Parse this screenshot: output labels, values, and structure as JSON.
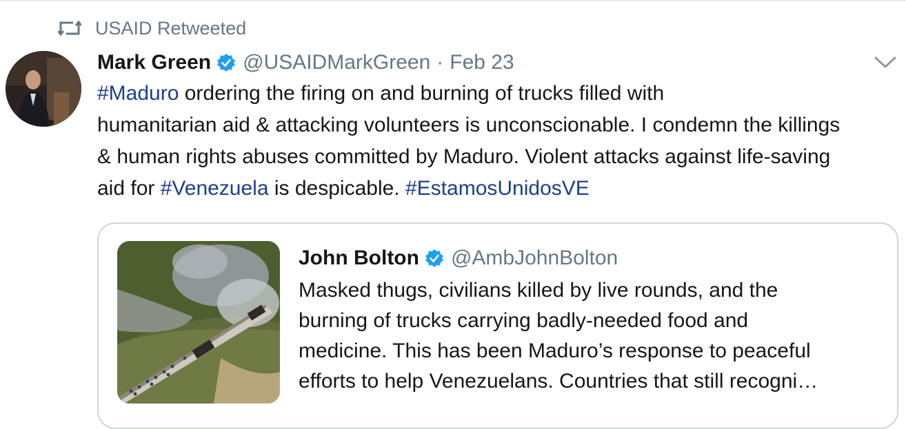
{
  "retweet": {
    "icon": "retweet-icon",
    "label": "USAID Retweeted"
  },
  "tweet": {
    "author_name": "Mark Green",
    "handle": "@USAIDMarkGreen",
    "separator": "·",
    "date": "Feb 23",
    "verified_icon": "verified-badge-icon",
    "menu_icon": "chevron-down-icon",
    "lines": [
      [
        {
          "t": "#Maduro",
          "tag": true
        },
        {
          "t": " ordering the firing on and burning of trucks filled with"
        }
      ],
      [
        {
          "t": "humanitarian aid & attacking volunteers is unconscionable. I condemn the killings"
        }
      ],
      [
        {
          "t": "& human rights abuses committed by Maduro. Violent attacks against life-saving"
        }
      ],
      [
        {
          "t": "aid for "
        },
        {
          "t": "#Venezuela",
          "tag": true
        },
        {
          "t": " is despicable. "
        },
        {
          "t": "#EstamosUnidosVE",
          "tag": true
        }
      ]
    ]
  },
  "quote": {
    "author_name": "John Bolton",
    "handle": "@AmbJohnBolton",
    "verified_icon": "verified-badge-icon",
    "image": "bridge-aerial-photo",
    "lines": [
      "Masked thugs, civilians killed by live rounds, and the",
      "burning of trucks carrying badly-needed food and",
      "medicine. This has been Maduro’s response to peaceful",
      "efforts to help Venezuelans. Countries that still recogni…"
    ]
  },
  "colors": {
    "link": "#1b3f8e",
    "secondary": "#657786",
    "verified": "#1da1f2",
    "border": "#ccd6dd"
  }
}
